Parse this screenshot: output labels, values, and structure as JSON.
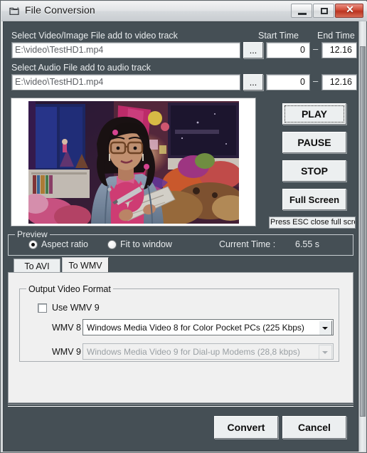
{
  "window": {
    "title": "File Conversion",
    "icon": "folder-icon",
    "buttons": {
      "minimize": "minimize-icon",
      "maximize": "maximize-icon",
      "close": "✕"
    }
  },
  "video_track": {
    "label": "Select Video/Image File add to video track",
    "path_value": "E:\\video\\TestHD1.mp4",
    "browse_label": "...",
    "start_time_label": "Start Time",
    "end_time_label": "End Time",
    "start_time_value": "0",
    "end_time_value": "12.16",
    "separator": "–"
  },
  "audio_track": {
    "label": "Select Audio File add to audio track",
    "path_value": "E:\\video\\TestHD1.mp4",
    "browse_label": "...",
    "start_time_value": "0",
    "end_time_value": "12.16",
    "separator": "–"
  },
  "player": {
    "play_label": "PLAY",
    "pause_label": "PAUSE",
    "stop_label": "STOP",
    "fullscreen_label": "Full Screen",
    "esc_note": "Press ESC close full screen"
  },
  "preview": {
    "group_label": "Preview",
    "aspect_ratio_label": "Aspect ratio",
    "fit_to_window_label": "Fit to window",
    "selected": "Aspect ratio",
    "current_time_label": "Current Time :",
    "current_time_value": "6.55 s"
  },
  "tabs": [
    {
      "label": "To AVI",
      "active": false
    },
    {
      "label": "To WMV",
      "active": true
    }
  ],
  "output_video_format": {
    "group_label": "Output Video Format",
    "use_wmv9_label": "Use WMV 9",
    "use_wmv9_checked": false,
    "wmv8_label": "WMV 8",
    "wmv8_value": "Windows Media Video 8 for Color Pocket PCs (225 Kbps)",
    "wmv9_label": "WMV 9",
    "wmv9_value": "Windows Media Video 9 for Dial-up Modems (28,8 kbps)",
    "wmv9_disabled": true
  },
  "footer": {
    "convert_label": "Convert",
    "cancel_label": "Cancel"
  },
  "colors": {
    "window_body": "#454f55",
    "panel": "#f0f0f0",
    "close_button": "#d2503c"
  }
}
